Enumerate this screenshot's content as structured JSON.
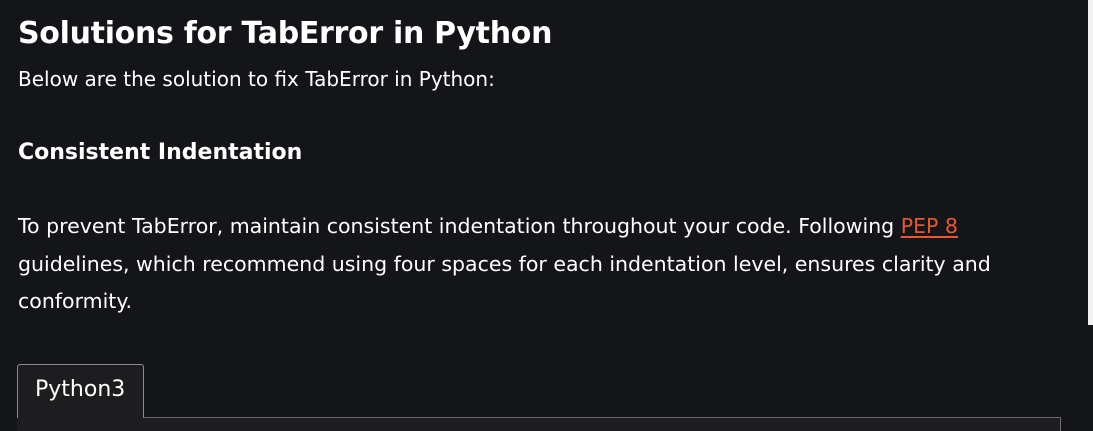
{
  "article": {
    "title": "Solutions for TabError in Python",
    "intro": "Below are the solution to fix TabError in Python:",
    "subheading": "Consistent Indentation",
    "paragraph": {
      "before_link": "To prevent TabError, maintain consistent indentation throughout your code. Following ",
      "link_text": "PEP 8",
      "after_link": " guidelines, which recommend using four spaces for each indentation level, ensures clarity and conformity."
    }
  },
  "code_tabs": {
    "active_tab": "Python3"
  },
  "colors": {
    "background": "#141518",
    "text": "#ffffff",
    "link": "#e8582e"
  }
}
